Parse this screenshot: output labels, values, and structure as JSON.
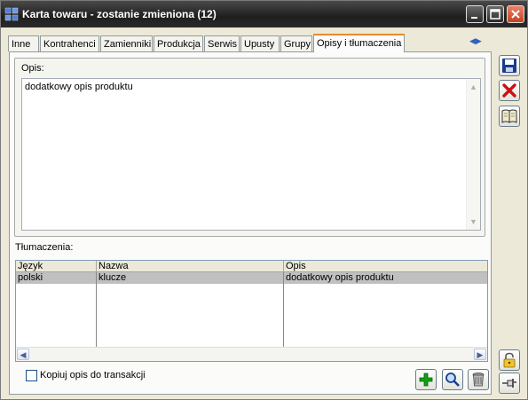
{
  "window": {
    "title": "Karta towaru - zostanie zmieniona (12)",
    "minimize_label": "_",
    "maximize_label": "□",
    "close_label": "✕"
  },
  "tabs": [
    {
      "label": "Inne"
    },
    {
      "label": "Kontrahenci"
    },
    {
      "label": "Zamienniki"
    },
    {
      "label": "Produkcja"
    },
    {
      "label": "Serwis"
    },
    {
      "label": "Upusty"
    },
    {
      "label": "Grupy"
    },
    {
      "label": "Opisy i tłumaczenia",
      "active": true
    }
  ],
  "tab_scroll": {
    "left": "◀",
    "right": "▶"
  },
  "description": {
    "label": "Opis:",
    "value": "dodatkowy opis produktu",
    "scroll_up": "▲",
    "scroll_down": "▼"
  },
  "translations": {
    "label": "Tłumaczenia:",
    "columns": [
      "Język",
      "Nazwa",
      "Opis"
    ],
    "rows": [
      {
        "language": "polski",
        "name": "klucze",
        "description": "dodatkowy opis produktu"
      }
    ],
    "scroll_left": "◀",
    "scroll_right": "▶"
  },
  "copy_checkbox": {
    "label": "Kopiuj opis do transakcji",
    "checked": false
  },
  "icons": {
    "save": "save-icon",
    "cancel": "cancel-icon",
    "book": "book-icon",
    "add": "add-icon",
    "search": "search-icon",
    "delete": "trash-icon",
    "lock": "lock-icon",
    "pin": "pin-icon"
  },
  "colors": {
    "title_bar": "#2b2b2b",
    "active_tab_accent": "#e68b2c",
    "selected_row": "#c0c0c0",
    "cancel_red": "#d01010",
    "add_green": "#12a012",
    "save_blue": "#1a3c8c"
  }
}
